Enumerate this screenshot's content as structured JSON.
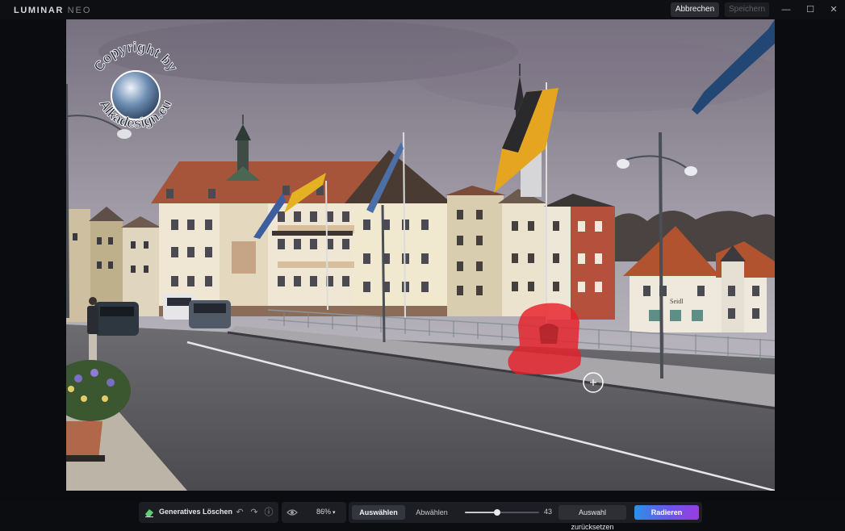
{
  "app": {
    "logo_main": "LUMINAR",
    "logo_sub": "NEO"
  },
  "titlebar": {
    "cancel_label": "Abbrechen",
    "save_label": "Speichern",
    "minimize_glyph": "—",
    "maximize_glyph": "☐",
    "close_glyph": "✕"
  },
  "watermark": {
    "text": "Copyright by Alkadesign.eu"
  },
  "photo": {
    "shop_sign": "Seidl",
    "mask_color": "#e8202a"
  },
  "toolbar": {
    "tool_name": "Generatives Löschen",
    "tool_icon": "eraser-icon",
    "undo_icon": "undo-icon",
    "redo_icon": "redo-icon",
    "info_icon": "info-icon",
    "eye_icon": "eye-icon",
    "zoom_label": "86%",
    "select_label": "Auswählen",
    "deselect_label": "Abwählen",
    "brush_size": 43,
    "brush_fraction": 0.43,
    "reset_label": "Auswahl zurücksetzen",
    "erase_label": "Radieren",
    "erase_gradient": [
      "#2d90e8",
      "#6a56e6",
      "#9a3ce0"
    ]
  }
}
